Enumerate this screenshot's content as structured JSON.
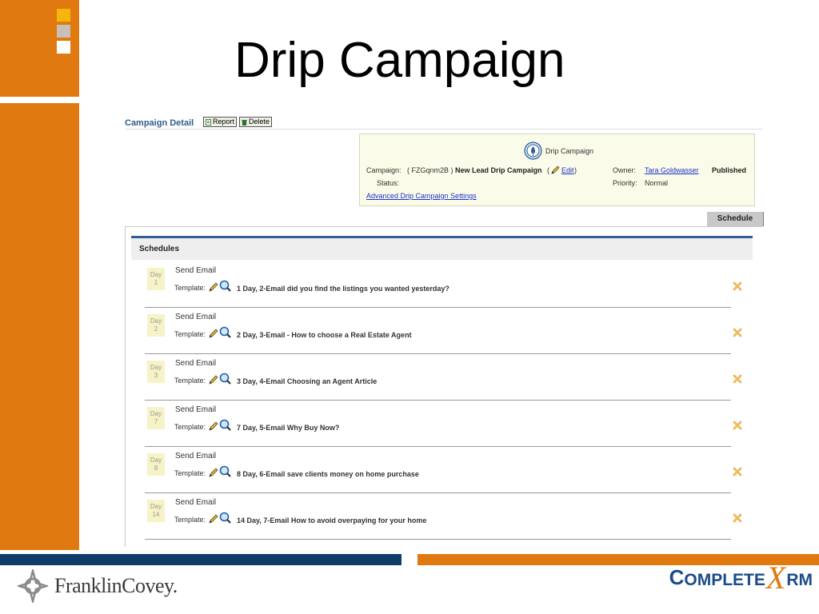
{
  "slide": {
    "title": "Drip Campaign"
  },
  "footer": {
    "left_logo_text": "FranklinCovey.",
    "right_logo": {
      "part1": "C",
      "part2": "OMPLETE",
      "part3": "X",
      "part4": "RM"
    }
  },
  "campaign_detail": {
    "title": "Campaign Detail",
    "report_label": "Report",
    "delete_label": "Delete",
    "type_label": "Drip Campaign",
    "campaign_label": "Campaign:",
    "campaign_code": "( FZGqnm2B )",
    "campaign_name": "New Lead Drip Campaign",
    "edit_open": "(",
    "edit_label": "Edit",
    "edit_close": ")",
    "owner_label": "Owner:",
    "owner_name": "Tara Goldwasser",
    "published_label": "Published",
    "status_label": "Status:",
    "priority_label": "Priority:",
    "priority_value": "Normal",
    "settings_link": "Advanced Drip Campaign Settings"
  },
  "tabs": {
    "schedule": "Schedule"
  },
  "schedules": {
    "title": "Schedules",
    "day_word": "Day",
    "action": "Send Email",
    "template_label": "Template:",
    "items": [
      {
        "day": "1",
        "template": "1 Day, 2-Email did you find the listings you wanted yesterday?"
      },
      {
        "day": "2",
        "template": "2 Day, 3-Email - How to choose a Real Estate Agent"
      },
      {
        "day": "3",
        "template": "3 Day, 4-Email Choosing an Agent Article"
      },
      {
        "day": "7",
        "template": "7 Day, 5-Email Why Buy Now?"
      },
      {
        "day": "8",
        "template": "8 Day, 6-Email save clients money on home purchase"
      },
      {
        "day": "14",
        "template": "14 Day, 7-Email How to avoid overpaying for your home"
      }
    ]
  },
  "colors": {
    "brand_orange": "#E07A10",
    "brand_navy": "#0E3C6B",
    "link_blue": "#1A35C8"
  }
}
